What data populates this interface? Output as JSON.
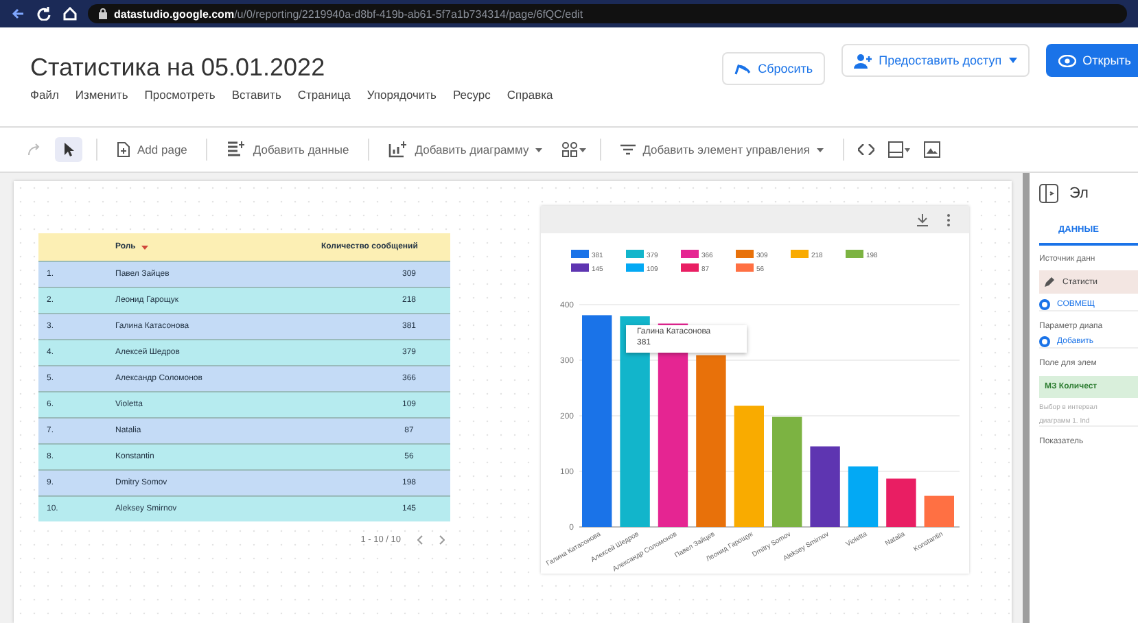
{
  "browser": {
    "url_host": "datastudio.google.com",
    "url_path": "/u/0/reporting/2219940a-d8bf-419b-ab61-5f7a1b734314/page/6fQC/edit"
  },
  "report": {
    "title": "Статистика на 05.01.2022",
    "menu": [
      "Файл",
      "Изменить",
      "Просмотреть",
      "Вставить",
      "Страница",
      "Упорядочить",
      "Ресурс",
      "Справка"
    ]
  },
  "header_buttons": [
    {
      "kind": "reset",
      "label": "Сбросить"
    },
    {
      "kind": "share",
      "label": "Предоставить доступ"
    },
    {
      "kind": "view",
      "label": "Открыть"
    }
  ],
  "toolbar": [
    {
      "kind": "add-page",
      "label": "Add page"
    },
    {
      "kind": "add-data",
      "label": "Добавить данные"
    },
    {
      "kind": "add-chart",
      "label": "Добавить диаграмму"
    },
    {
      "kind": "add-control",
      "label": "Добавить элемент управления"
    }
  ],
  "table": {
    "columns": [
      "Роль",
      "Количество сообщений"
    ],
    "rows": [
      {
        "index": "1.",
        "name": "Павел Зайцев",
        "count": "309"
      },
      {
        "index": "2.",
        "name": "Леонид Гарощук",
        "count": "218"
      },
      {
        "index": "3.",
        "name": "Галина Катасонова",
        "count": "381"
      },
      {
        "index": "4.",
        "name": "Алексей Шедров",
        "count": "379"
      },
      {
        "index": "5.",
        "name": "Александр Соломонов",
        "count": "366"
      },
      {
        "index": "6.",
        "name": "Violetta",
        "count": "109"
      },
      {
        "index": "7.",
        "name": "Natalia",
        "count": "87"
      },
      {
        "index": "8.",
        "name": "Konstantin",
        "count": "56"
      },
      {
        "index": "9.",
        "name": "Dmitry Somov",
        "count": "198"
      },
      {
        "index": "10.",
        "name": "Aleksey Smirnov",
        "count": "145"
      }
    ],
    "pagination": "1 - 10 / 10"
  },
  "chart": {
    "legend": [
      {
        "label": "381",
        "color": "#1a73e8"
      },
      {
        "label": "379",
        "color": "#12b5cb"
      },
      {
        "label": "366",
        "color": "#e52592"
      },
      {
        "label": "309",
        "color": "#e8710a"
      },
      {
        "label": "218",
        "color": "#f9ab00"
      },
      {
        "label": "198",
        "color": "#7cb342"
      },
      {
        "label": "145",
        "color": "#5e35b1"
      },
      {
        "label": "109",
        "color": "#03a9f4"
      },
      {
        "label": "87",
        "color": "#e91e63"
      },
      {
        "label": "56",
        "color": "#ff7043"
      }
    ],
    "tooltip": {
      "title": "Галина Катасонова",
      "value": "381"
    },
    "chart_data": {
      "type": "bar",
      "categories": [
        "Галина Катасонова",
        "Алексей Шедров",
        "Александр Соломонов",
        "Павел Зайцев",
        "Леонид Гарощук",
        "Dmitry Somov",
        "Aleksey Smirnov",
        "Violetta",
        "Natalia",
        "Konstantin"
      ],
      "series": [
        {
          "values": [
            381,
            379,
            366,
            309,
            218,
            198,
            145,
            109,
            87,
            56
          ]
        }
      ],
      "ylim": [
        0,
        400
      ],
      "grid": true,
      "yticks": [
        0,
        100,
        200,
        300,
        400
      ]
    }
  },
  "panel": {
    "title": "Эл",
    "tabs": [
      {
        "label": "ДАННЫЕ",
        "selected": true
      }
    ],
    "items": [
      {
        "kind": "label",
        "text": "Источник данн"
      },
      {
        "kind": "source",
        "text": "Статисти"
      },
      {
        "kind": "add",
        "text": "СОВМЕЩ"
      },
      {
        "kind": "label",
        "text": "Параметр диапа"
      },
      {
        "kind": "add",
        "text": "Добавить"
      },
      {
        "kind": "label",
        "text": "Поле для элем"
      },
      {
        "kind": "field",
        "text": "МЗ Количест"
      },
      {
        "kind": "hint",
        "text": "Выбор в интервал"
      },
      {
        "kind": "hint",
        "text": "диаграмм 1. Ind"
      },
      {
        "kind": "label",
        "text": "Показатель"
      }
    ]
  }
}
